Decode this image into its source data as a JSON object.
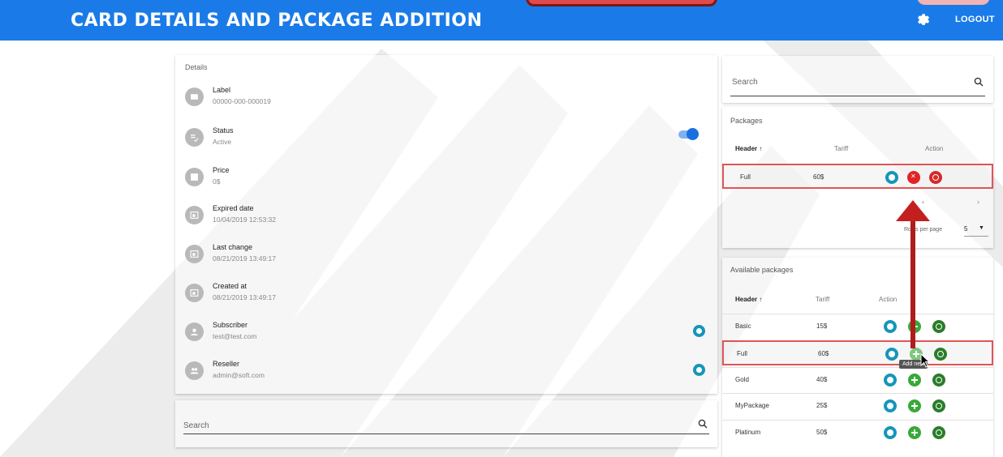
{
  "header": {
    "title": "CARD DETAILS AND PACKAGE ADDITION",
    "logout_label": "LOGOUT",
    "settings_icon": "gear-icon",
    "brand_color": "#1a7be8"
  },
  "details": {
    "heading": "Details",
    "fields": [
      {
        "label": "Label",
        "value": "00000-000-000019",
        "icon": "folder-icon"
      },
      {
        "label": "Status",
        "value": "Active",
        "icon": "playlist-check-icon",
        "toggle_on": true
      },
      {
        "label": "Price",
        "value": "0$",
        "icon": "card-icon"
      },
      {
        "label": "Expired date",
        "value": "10/04/2019 12:53:32",
        "icon": "calendar-icon"
      },
      {
        "label": "Last change",
        "value": "08/21/2019 13:49:17",
        "icon": "calendar-icon"
      },
      {
        "label": "Created at",
        "value": "08/21/2019 13:49:17",
        "icon": "calendar-icon"
      },
      {
        "label": "Subscriber",
        "value": "test@test.com",
        "icon": "person-icon"
      },
      {
        "label": "Reseller",
        "value": "admin@soft.com",
        "icon": "people-icon"
      }
    ]
  },
  "search_bottom": {
    "placeholder": "Search"
  },
  "search_top": {
    "placeholder": "Search"
  },
  "packages": {
    "title": "Packages",
    "columns": [
      "Header",
      "Tariff",
      "Action"
    ],
    "rows": [
      {
        "name": "Full",
        "tariff": "60$"
      }
    ],
    "pager_prev": "‹",
    "pager_next": "›",
    "rows_per_page_label": "Rows per page",
    "rows_per_page_value": "5"
  },
  "available_packages": {
    "title": "Available packages",
    "columns": [
      "Header",
      "Tariff",
      "Action"
    ],
    "rows": [
      {
        "name": "Basic",
        "tariff": "15$"
      },
      {
        "name": "Full",
        "tariff": "60$"
      },
      {
        "name": "Gold",
        "tariff": "40$"
      },
      {
        "name": "MyPackage",
        "tariff": "25$"
      },
      {
        "name": "Platinum",
        "tariff": "50$"
      }
    ],
    "tooltip": "Add new"
  },
  "colors": {
    "highlight_border": "#e05555",
    "info": "#1596b8",
    "add": "#39a838",
    "delete": "#e02424"
  }
}
